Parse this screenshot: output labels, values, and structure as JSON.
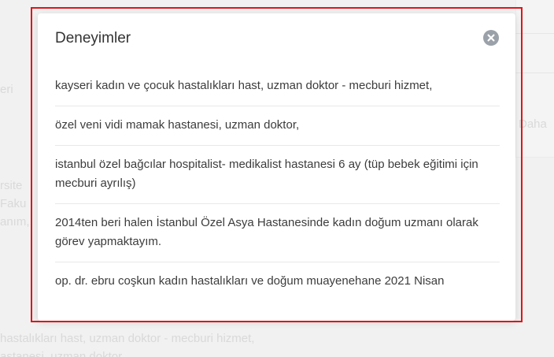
{
  "background": {
    "fragments": [
      "eri",
      "rsite",
      "Faku",
      "anım,",
      "Daha"
    ],
    "bottom_line1": "hastalıkları hast, uzman doktor - mecburi hizmet,",
    "bottom_line2": "astanesi, uzman doktor,"
  },
  "modal": {
    "title": "Deneyimler",
    "close_icon": "close-icon",
    "items": [
      "kayseri kadın ve çocuk hastalıkları hast, uzman doktor - mecburi hizmet,",
      "özel veni vidi mamak hastanesi, uzman doktor,",
      "istanbul özel bağcılar hospitalist- medikalist hastanesi 6 ay (tüp bebek eğitimi için mecburi ayrılış)",
      "2014ten beri halen İstanbul Özel Asya Hastanesinde kadın doğum uzmanı olarak görev yapmaktayım.",
      "op. dr. ebru coşkun kadın hastalıkları ve doğum muayenehane 2021 Nisan"
    ]
  },
  "colors": {
    "highlight_border": "#e0141a",
    "close_button": "#9aa1a8"
  }
}
